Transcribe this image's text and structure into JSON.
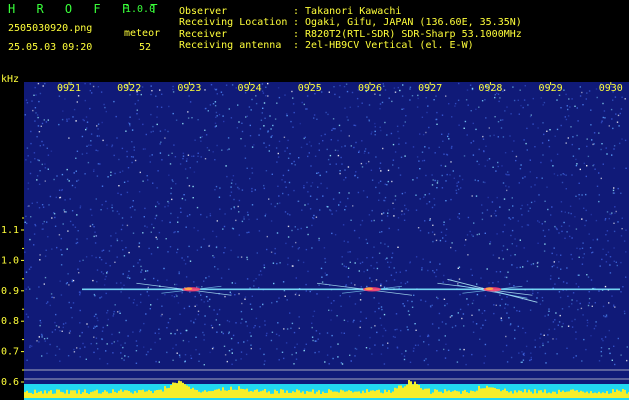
{
  "app": {
    "name": "H R O F F T",
    "version": "1.0.0"
  },
  "file": {
    "name": "2505030920.png",
    "date": "25.05.03 09:20"
  },
  "meteor": {
    "label": "meteor",
    "count": "52"
  },
  "info": {
    "observer": {
      "label": "Observer",
      "value": ": Takanori Kawachi"
    },
    "location": {
      "label": "Receiving Location",
      "value": ": Ogaki, Gifu, JAPAN (136.60E, 35.35N)"
    },
    "receiver": {
      "label": "Receiver",
      "value": ": R820T2(RTL-SDR) SDR-Sharp 53.1000MHz"
    },
    "antenna": {
      "label": "Receiving antenna",
      "value": ": 2el-HB9CV Vertical (el. E-W)"
    }
  },
  "colors": {
    "background": "#000000",
    "header_text": "#ffff3a",
    "app_title": "#39ff3a",
    "spectrum_bg": "#101a78"
  },
  "chart_data": {
    "type": "heatmap",
    "ylabel": "kHz",
    "x_ticks": [
      "0921",
      "0922",
      "0923",
      "0924",
      "0925",
      "0926",
      "0927",
      "0928",
      "0929",
      "0930"
    ],
    "y_ticks": [
      "1.1",
      "1.0",
      "0.9",
      "0.8",
      "0.7",
      "0.6"
    ],
    "y_values": [
      1.1,
      1.0,
      0.9,
      0.8,
      0.7,
      0.6
    ],
    "ylim": [
      0.58,
      1.18
    ],
    "carrier_khz": 0.905,
    "meteor_echoes": [
      {
        "time": "0923",
        "khz": 0.905
      },
      {
        "time": "0926",
        "khz": 0.905
      },
      {
        "time": "0928",
        "khz": 0.905
      }
    ]
  }
}
